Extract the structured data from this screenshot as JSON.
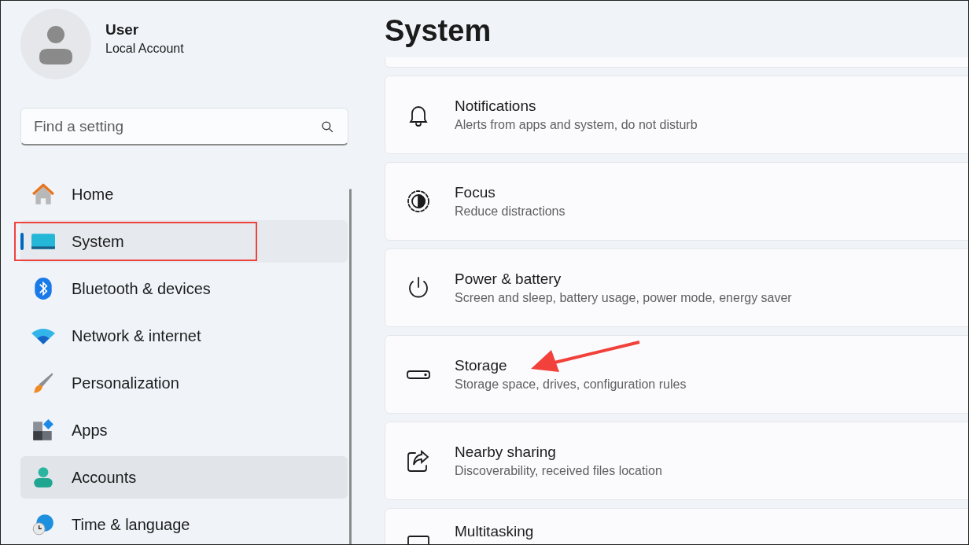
{
  "user": {
    "name": "User",
    "account": "Local Account"
  },
  "search": {
    "placeholder": "Find a setting"
  },
  "sidebar": {
    "items": [
      {
        "label": "Home",
        "kind": "home",
        "selected": false,
        "hovered": false,
        "outlined": false
      },
      {
        "label": "System",
        "kind": "system",
        "selected": true,
        "hovered": false,
        "outlined": true
      },
      {
        "label": "Bluetooth & devices",
        "kind": "bluetooth",
        "selected": false,
        "hovered": false,
        "outlined": false
      },
      {
        "label": "Network & internet",
        "kind": "network",
        "selected": false,
        "hovered": false,
        "outlined": false
      },
      {
        "label": "Personalization",
        "kind": "personalization",
        "selected": false,
        "hovered": false,
        "outlined": false
      },
      {
        "label": "Apps",
        "kind": "apps",
        "selected": false,
        "hovered": false,
        "outlined": false
      },
      {
        "label": "Accounts",
        "kind": "accounts",
        "selected": false,
        "hovered": true,
        "outlined": false
      },
      {
        "label": "Time & language",
        "kind": "time",
        "selected": false,
        "hovered": false,
        "outlined": false
      }
    ]
  },
  "page": {
    "title": "System",
    "cards": [
      {
        "title": "Notifications",
        "subtitle": "Alerts from apps and system, do not disturb",
        "kind": "bell",
        "arrow": false
      },
      {
        "title": "Focus",
        "subtitle": "Reduce distractions",
        "kind": "focus",
        "arrow": false
      },
      {
        "title": "Power & battery",
        "subtitle": "Screen and sleep, battery usage, power mode, energy saver",
        "kind": "power",
        "arrow": false
      },
      {
        "title": "Storage",
        "subtitle": "Storage space, drives, configuration rules",
        "kind": "storage",
        "arrow": true
      },
      {
        "title": "Nearby sharing",
        "subtitle": "Discoverability, received files location",
        "kind": "share",
        "arrow": false
      },
      {
        "title": "Multitasking",
        "kind": "multitask",
        "arrow": false
      }
    ]
  }
}
